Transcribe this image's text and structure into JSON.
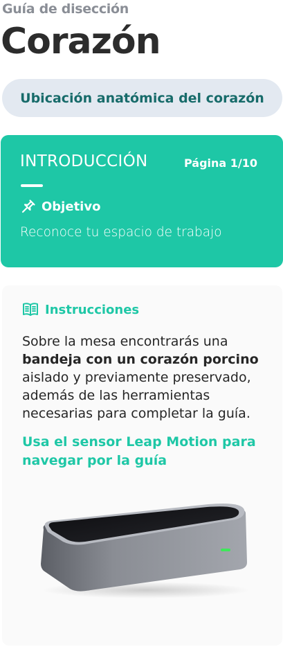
{
  "header": {
    "subtitle": "Guía de disección",
    "title": "Corazón"
  },
  "section_pill": {
    "label": "Ubicación anatómica del corazón"
  },
  "intro_card": {
    "heading": "INTRODUCCIÓN",
    "page_indicator": "Página 1/10",
    "objective_label": "Objetivo",
    "objective_icon": "pin-icon",
    "objective_text": "Reconoce tu espacio de trabajo",
    "color": "#1ec7a6"
  },
  "instructions_card": {
    "label": "Instrucciones",
    "icon": "book-icon",
    "text_before": "Sobre la mesa encontrarás una ",
    "text_bold": "bandeja con un corazón porcino",
    "text_after": " aislado y previamente preservado, además de las herramientas necesarias para completar la guía.",
    "hint": "Usa el sensor Leap Motion para navegar por la guía",
    "image": "leap-motion-sensor"
  },
  "colors": {
    "accent": "#1ec7a6",
    "pill_bg": "#e3e9f1",
    "pill_text": "#176b6a",
    "title": "#2c2c2c",
    "subtitle": "#8a8e96"
  }
}
